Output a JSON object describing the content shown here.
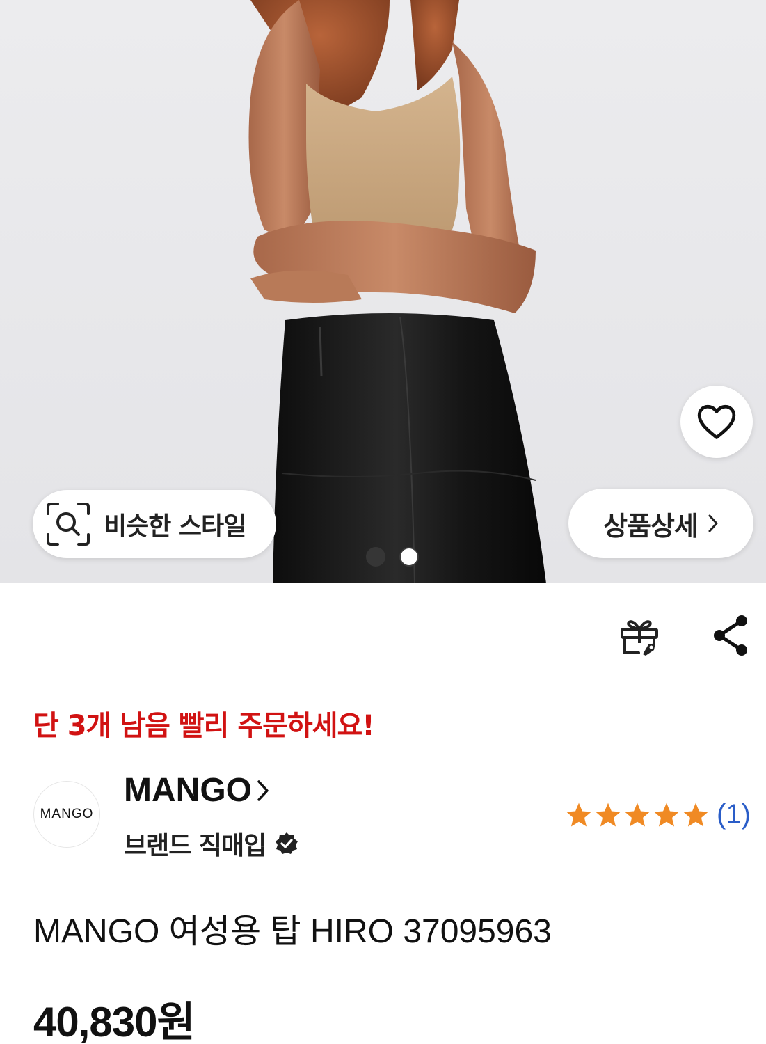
{
  "hero": {
    "image_alt": "product photo",
    "similar_style_label": "비슷한 스타일",
    "detail_label": "상품상세",
    "carousel": {
      "total": 2,
      "active": 2
    }
  },
  "actions": {
    "gift_icon": "gift-icon",
    "share_icon": "share-icon"
  },
  "stock_alert": "단 3개 남음 빨리 주문하세요!",
  "brand": {
    "logo_text": "MANGO",
    "name": "MANGO",
    "type": "브랜드 직매입"
  },
  "rating": {
    "stars": 5,
    "count": "(1)"
  },
  "product": {
    "title": "MANGO 여성용 탑 HIRO 37095963",
    "price": "40,830원"
  },
  "colors": {
    "alert": "#d11212",
    "star": "#f08a24",
    "rating_count": "#2a5dc8"
  }
}
